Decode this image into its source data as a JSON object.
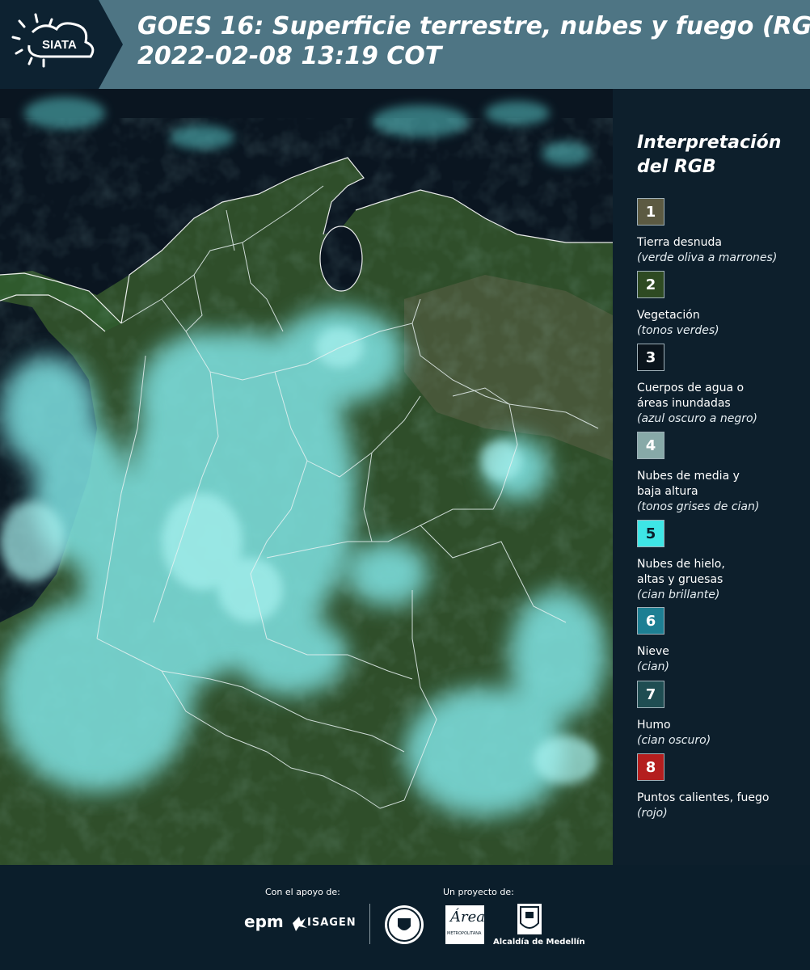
{
  "header": {
    "logo_text": "SIATA",
    "title_line1": "GOES 16: Superficie terrestre, nubes y fuego (RGB)",
    "title_line2": " 2022-02-08 13:19 COT"
  },
  "legend": {
    "title_line1": "Interpretación",
    "title_line2": "del RGB",
    "items": [
      {
        "number": "1",
        "label": "Tierra desnuda",
        "desc": "(verde oliva a marrones)",
        "color": "#5c5a42"
      },
      {
        "number": "2",
        "label": "Vegetación",
        "desc": "(tonos verdes)",
        "color": "#2e4a22"
      },
      {
        "number": "3",
        "label": "Cuerpos de agua o áreas inundadas",
        "desc": "(azul oscuro a negro)",
        "color": "#0a141c"
      },
      {
        "number": "4",
        "label": "Nubes de media y baja altura",
        "desc": "(tonos grises de cian)",
        "color": "#87a9a8"
      },
      {
        "number": "5",
        "label": "Nubes de hielo, altas y gruesas",
        "desc": "(cian brillante)",
        "color": "#3ee6e6"
      },
      {
        "number": "6",
        "label": "Nieve",
        "desc": "(cian)",
        "color": "#1d7f93"
      },
      {
        "number": "7",
        "label": "Humo",
        "desc": "(cian oscuro)",
        "color": "#1f4d52"
      },
      {
        "number": "8",
        "label": "Puntos calientes, fuego",
        "desc": "(rojo)",
        "color": "#b41e1e"
      }
    ]
  },
  "footer": {
    "support_label": "Con el apoyo de:",
    "project_label": "Un proyecto de:",
    "epm": "epm",
    "isagen": "ISAGEN",
    "area_metro": "Área",
    "area_metro_sub": "METROPOLITANA",
    "alcaldia": "Alcaldía de Medellín"
  }
}
